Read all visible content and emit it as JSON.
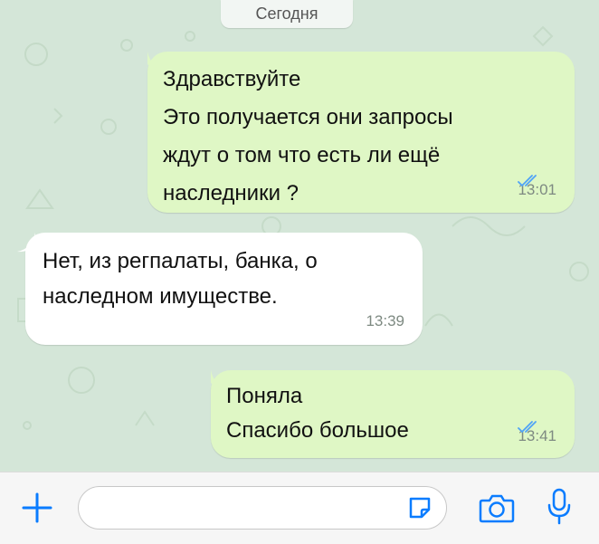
{
  "date_separator": "Сегодня",
  "messages": [
    {
      "direction": "outgoing",
      "lines": [
        "Здравствуйте",
        "Это получается они запросы",
        "ждут о том что есть ли ещё",
        "наследники ?"
      ],
      "time": "13:01",
      "status": "read"
    },
    {
      "direction": "incoming",
      "lines": [
        "Нет, из регпалаты, банка, о",
        "наследном имуществе."
      ],
      "time": "13:39"
    },
    {
      "direction": "outgoing",
      "lines": [
        "Поняла",
        "Спасибо большое"
      ],
      "time": "13:41",
      "status": "read"
    }
  ],
  "input_bar": {
    "icons": [
      "plus-icon",
      "sticker-icon",
      "camera-icon",
      "microphone-icon"
    ],
    "message_value": ""
  },
  "colors": {
    "accent": "#0a7cff",
    "outgoing_bubble": "#dff7c5",
    "incoming_bubble": "#ffffff",
    "chat_background": "#d4e6d8",
    "read_ticks": "#4fa3f7"
  }
}
